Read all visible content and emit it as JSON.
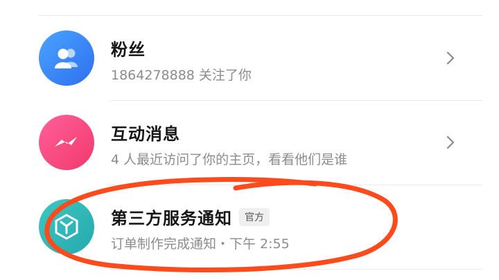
{
  "list": {
    "items": [
      {
        "title": "粉丝",
        "subtitle": "1864278888 关注了你",
        "icon": "fans-icon",
        "color": "#3a86f7"
      },
      {
        "title": "互动消息",
        "subtitle": "4 人最近访问了你的主页，看看他们是谁",
        "icon": "message-icon",
        "color": "#f7467a"
      },
      {
        "title": "第三方服务通知",
        "badge": "官方",
        "subtitle": "订单制作完成通知・下午 2:55",
        "icon": "cube-icon",
        "color": "#2fb8b6"
      }
    ]
  },
  "annotation_color": "#ff4a1c"
}
